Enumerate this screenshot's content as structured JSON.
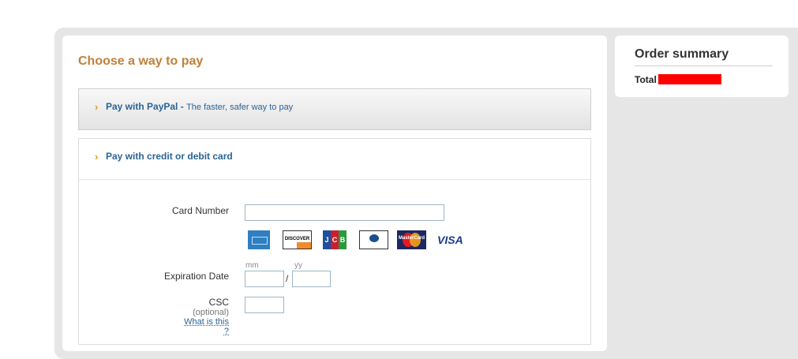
{
  "payment": {
    "title": "Choose a way to pay",
    "paypal_option": {
      "label": "Pay with PayPal -",
      "tagline": "The faster, safer way to pay"
    },
    "card_option": {
      "label": "Pay with credit or debit card",
      "card_number_label": "Card Number",
      "card_number_value": "",
      "accepted_cards": [
        "American Express",
        "Discover",
        "JCB",
        "Diners Club",
        "MasterCard",
        "Visa"
      ],
      "discover_text": "DISCOVER",
      "jcb_letters": [
        "J",
        "C",
        "B"
      ],
      "mastercard_text": "MasterCard",
      "visa_text": "VISA",
      "expiration_label": "Expiration Date",
      "month_hint": "mm",
      "year_hint": "yy",
      "month_value": "",
      "year_value": "",
      "separator": "/",
      "csc_label": "CSC",
      "csc_optional": "(optional)",
      "csc_value": "",
      "whats_this": "What is this ?"
    }
  },
  "order_summary": {
    "title": "Order summary",
    "total_label": "Total"
  },
  "colors": {
    "title": "#c0803a",
    "link": "#2a6496",
    "chevron": "#d89a2e",
    "redaction": "#ff0000",
    "background": "#e6e6e6"
  }
}
